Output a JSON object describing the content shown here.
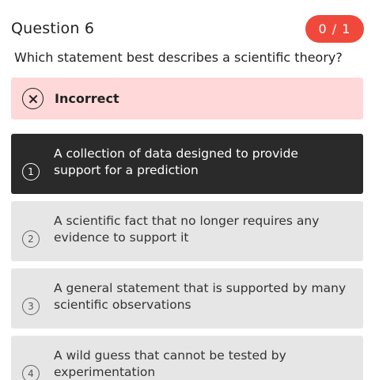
{
  "header": {
    "title": "Question 6",
    "score": "0 / 1"
  },
  "question": {
    "text": "Which statement best describes a scientific theory?"
  },
  "feedback": {
    "label": "Incorrect",
    "icon": "x-circle-icon",
    "background_color": "#ffd9d9"
  },
  "options": [
    {
      "number": "1",
      "text": "A collection of data designed to provide support for a prediction",
      "selected": true
    },
    {
      "number": "2",
      "text": "A scientific fact that no longer requires any evidence to support it",
      "selected": false
    },
    {
      "number": "3",
      "text": "A general statement that is supported by many scientific observations",
      "selected": false
    },
    {
      "number": "4",
      "text": "A wild guess that cannot be tested by experimentation",
      "selected": false
    }
  ],
  "colors": {
    "score_badge": "#f0493c",
    "selected_option": "#2a2a2a",
    "option_background": "#e6e6e6"
  }
}
